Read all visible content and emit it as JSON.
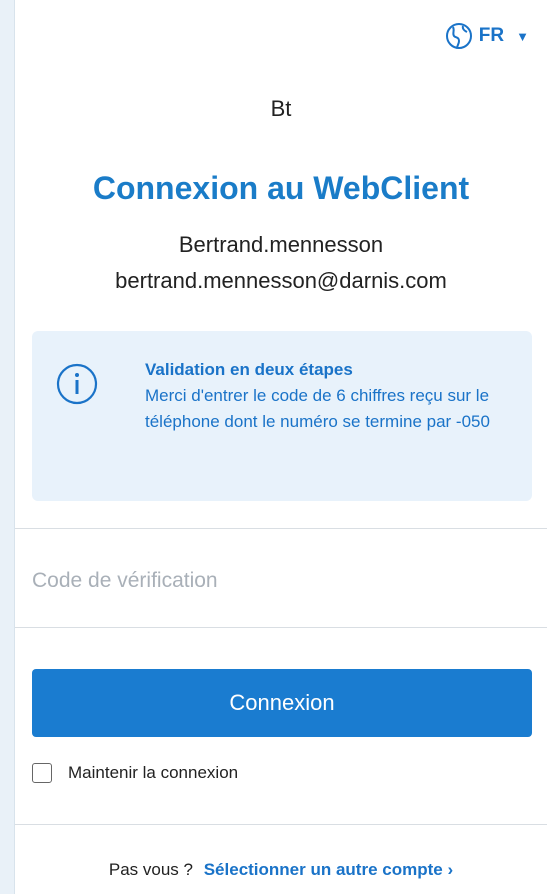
{
  "language": {
    "code": "FR",
    "globe_icon": "globe-icon",
    "caret_icon": "caret-down-icon",
    "caret_glyph": "▼"
  },
  "avatar": {
    "initials": "Bt"
  },
  "title": "Connexion au WebClient",
  "account": {
    "username": "Bertrand.mennesson",
    "email": "bertrand.mennesson@darnis.com"
  },
  "info": {
    "icon": "info-icon",
    "title": "Validation en deux étapes",
    "body": "Merci d'entrer le code de 6 chiffres reçu sur le téléphone dont le numéro se termine par -050"
  },
  "verification": {
    "placeholder": "Code de vérification",
    "value": ""
  },
  "connect_button": "Connexion",
  "remember": {
    "label": "Maintenir la connexion",
    "checked": false
  },
  "footer": {
    "prefix": "Pas vous ?",
    "link": "Sélectionner un autre compte ›"
  },
  "colors": {
    "accent": "#1a7cd0",
    "info_bg": "#e8f2fb"
  }
}
